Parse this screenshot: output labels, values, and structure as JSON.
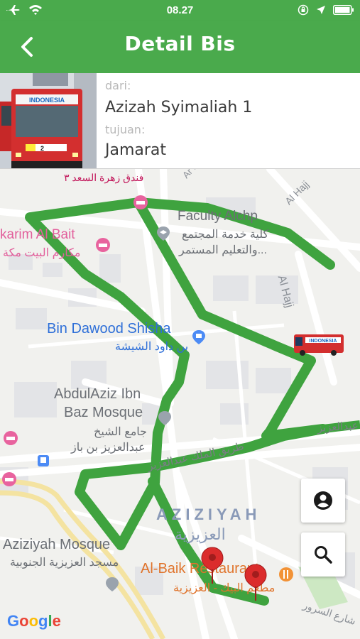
{
  "status": {
    "time": "08.27"
  },
  "header": {
    "title": "Detail Bis"
  },
  "info": {
    "from_label": "dari:",
    "from_value": "Azizah Syimaliah 1",
    "to_label": "tujuan:",
    "to_value": "Jamarat",
    "bus_sign": "INDONESIA",
    "bus_number": "2"
  },
  "map": {
    "hotel_ar": "فندق زهرة السعد ٣",
    "road_ar_ri": "Ar Ri",
    "al_hajj_1": "Al Hajj",
    "al_hajj_2": "Al Hajj",
    "faculty_en": "Faculty Alchp",
    "faculty_ar_1": "كلية خدمة المجتمع",
    "faculty_ar_2": "والتعليم المستمر...",
    "karim_en": "karim Al Bait",
    "karim_ar": "مكارم البيت مكة",
    "shisha_en": "Bin Dawood Shisha",
    "shisha_ar": "بن داود الشيشة",
    "mosque1_en_1": "AbdulAziz Ibn",
    "mosque1_en_2": "Baz Mosque",
    "mosque1_ar_1": "جامع الشيخ",
    "mosque1_ar_2": "عبدالعزيز بن باز",
    "road_king": "طريق الملك عبدالعزيز",
    "road_king_2": "عبدالعزيز",
    "aziziyah_en": "AZIZIYAH",
    "aziziyah_ar": "العزيزية",
    "mosque2_en": "Aziziyah Mosque",
    "mosque2_ar": "مسجد العزيزية الجنوبية",
    "albaik_en": "Al-Baik Restaurant",
    "albaik_ar": "مطعم البيك - العزيزية",
    "sorour_ar": "شارع السرور",
    "google": "Google"
  },
  "colors": {
    "primary": "#4aaa4c",
    "route": "#43a047",
    "marker": "#db2c2c"
  },
  "icons": [
    "airplane-icon",
    "wifi-icon",
    "lock-rotation-icon",
    "location-arrow-icon",
    "battery-icon",
    "back-arrow-icon",
    "user-location-icon",
    "search-icon",
    "map-pin-icon",
    "bus-icon"
  ]
}
